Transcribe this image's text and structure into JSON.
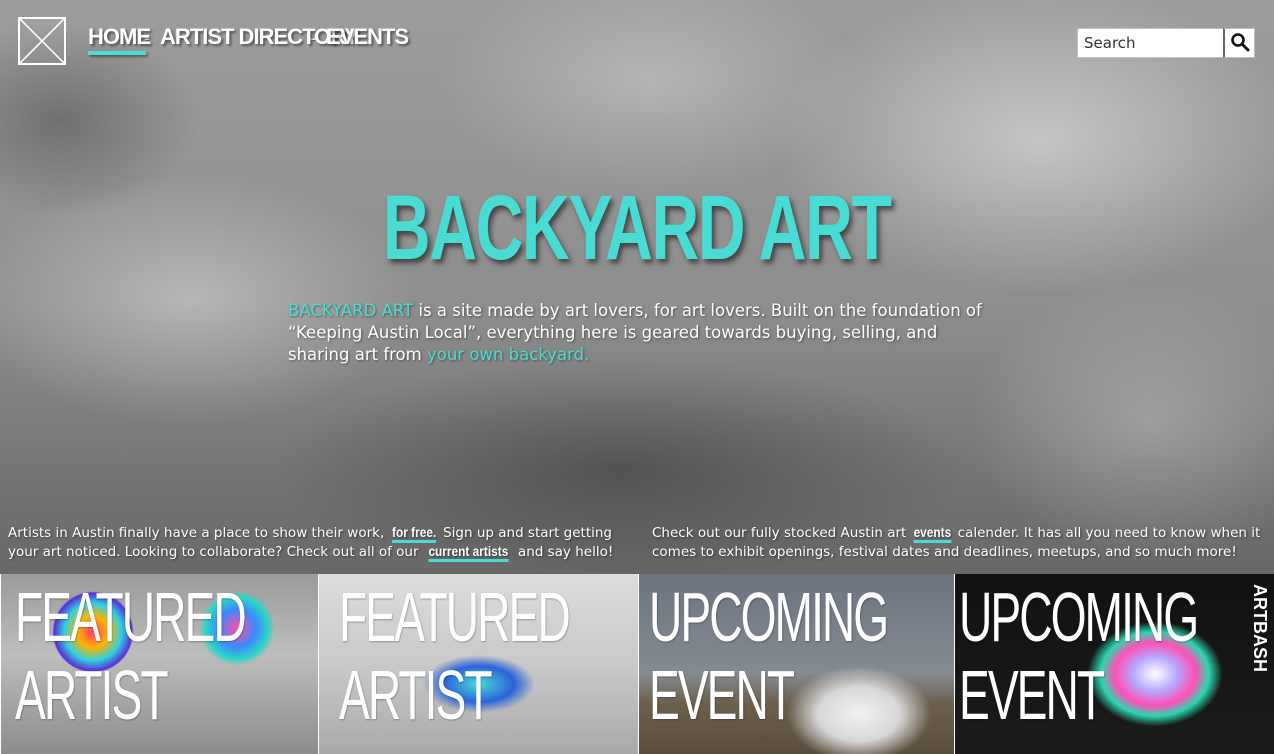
{
  "colors": {
    "accent": "#49dcd4",
    "text": "#ffffff"
  },
  "header": {
    "logo_icon": "x-box-logo-icon",
    "nav": [
      {
        "label": "HOME",
        "active": true
      },
      {
        "label": "ARTIST DIRECTORY",
        "active": false
      },
      {
        "label": "EVENTS",
        "active": false
      }
    ],
    "nav_separator": "-",
    "search": {
      "placeholder": "Search",
      "value": "",
      "button_icon": "search-icon"
    }
  },
  "hero": {
    "title": "BACKYARD ART",
    "desc_brand": "BACKYARD ART",
    "desc_text": " is a site made by art lovers, for art lovers. Built on the foundation of “Keeping Austin Local”, everything here is geared towards buying, selling, and sharing art from ",
    "desc_link": "your own backyard."
  },
  "info": {
    "left": {
      "text1": "Artists in Austin finally have a place to show their work, ",
      "link1": "for free.",
      "text2": " Sign up and start getting your art noticed. Looking to collaborate? Check out all of our ",
      "link2": "current artists",
      "text3": " and say hello!"
    },
    "right": {
      "text1": "Check out our fully stocked Austin art ",
      "link1": "events",
      "text2": " calender. It has all you need to know when it comes to exhibit openings, festival dates and deadlines, meetups, and so much more!"
    }
  },
  "tiles": [
    {
      "line1": "FEATURED",
      "line2": "ARTIST"
    },
    {
      "line1": "FEATURED",
      "line2": "ARTIST"
    },
    {
      "line1": "UPCOMING",
      "line2": "EVENT"
    },
    {
      "line1": "UPCOMING",
      "line2": "EVENT",
      "badge": "ARTBASH"
    }
  ]
}
